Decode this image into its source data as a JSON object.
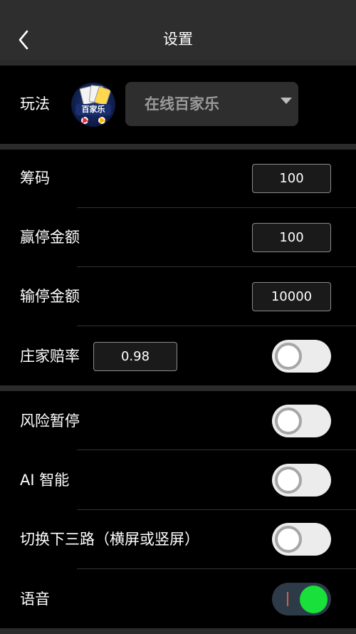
{
  "header": {
    "title": "设置",
    "back_icon": "chevron-left-icon"
  },
  "game": {
    "label": "玩法",
    "logo_text": "百家乐",
    "selected": "在线百家乐"
  },
  "settings": {
    "chips": {
      "label": "筹码",
      "value": "100"
    },
    "stop_win": {
      "label": "赢停金额",
      "value": "100"
    },
    "stop_loss": {
      "label": "输停金额",
      "value": "10000"
    },
    "banker_odds": {
      "label": "庄家赔率",
      "value": "0.98",
      "toggle_on": false
    }
  },
  "toggles": {
    "risk_pause": {
      "label": "风险暂停",
      "on": false
    },
    "ai": {
      "label": "AI 智能",
      "on": false
    },
    "switch_road": {
      "label": "切换下三路（横屏或竖屏）",
      "on": false
    },
    "voice": {
      "label": "语音",
      "on": true
    }
  },
  "colors": {
    "background": "#000000",
    "header": "#2e2e2e",
    "toggle_on_knob": "#19e03a",
    "toggle_off_track": "#ececec"
  }
}
